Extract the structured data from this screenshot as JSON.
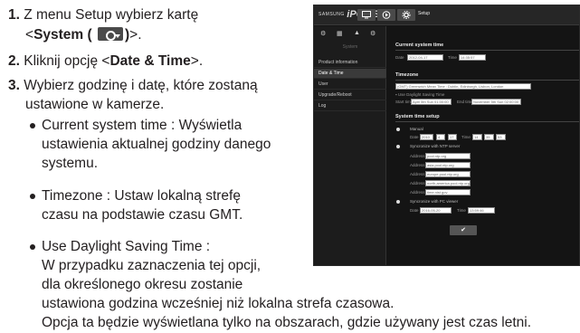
{
  "doc": {
    "step1_num": "1.",
    "step1_a": "Z menu Setup wybierz kartę",
    "step1_b_pre": "<",
    "step1_b_bold": "System (",
    "step1_b_bold2": ")",
    "step1_b_post": ">.",
    "step2_num": "2.",
    "step2_pre": "Kliknij opcję <",
    "step2_bold": "Date & Time",
    "step2_post": ">.",
    "step3_num": "3.",
    "step3_a": "Wybierz godzinę i datę, które zostaną",
    "step3_b": "ustawione w kamerze.",
    "bullet1_a": "Current system time : Wyświetla",
    "bullet1_b": "ustawienia aktualnej godziny danego",
    "bullet1_c": "systemu.",
    "bullet2_a": "Timezone : Ustaw lokalną strefę",
    "bullet2_b": "czasu na podstawie czasu GMT.",
    "bullet3_a": "Use Daylight Saving Time :",
    "bullet3_b": "W przypadku zaznaczenia tej opcji,",
    "bullet3_c": "dla określonego okresu zostanie",
    "bullet3_d": "ustawiona godzina wcześniej niż lokalna strefa czasowa.",
    "bullet3_e": "Opcja ta będzie wyświetlana tylko na obszarach, gdzie używany jest czas letni."
  },
  "screenshot": {
    "brand_small": "SAMSUNG",
    "brand_main": "iPOLiS",
    "tab_title": "Setup",
    "sidebar": {
      "category": "System",
      "items": [
        "Product information",
        "Date & Time",
        "User",
        "Upgrade/Reboot",
        "Log"
      ]
    },
    "current_time": {
      "heading": "Current system time",
      "date_label": "Date",
      "date_value": "2012-04-17",
      "time_label": "Time",
      "time_value": "14:35:57"
    },
    "timezone": {
      "heading": "Timezone",
      "value": "(GMT) Greenwich Mean Time : Dublin, Edinburgh, Lisbon, London",
      "dst_label": "Use Daylight Saving Time",
      "start_label": "Start time",
      "start_value": "April 5th Sun 01:00:00",
      "end_label": "End time",
      "end_value": "November 5th Sun 02:00:00"
    },
    "setup": {
      "heading": "System time setup",
      "manual": "Manual",
      "date_label": "Date",
      "year": "2010",
      "month": "4",
      "day": "17",
      "time_label": "Time",
      "hour": "14",
      "minute": "35",
      "second": "53",
      "ntp": "Syncronize with NTP server",
      "address_label": "Address",
      "addresses": [
        "pool.ntp.org",
        "asia.pool.ntp.org",
        "europe.pool.ntp.org",
        "north-america.pool.ntp.org",
        "time.nist.gov"
      ],
      "pc": "Syncronize with PC viewer",
      "pc_date": "2016-05-20",
      "pc_time": "13:59:46",
      "pc_date_label": "Date",
      "pc_time_label": "Time",
      "ok_glyph": "✔"
    }
  }
}
